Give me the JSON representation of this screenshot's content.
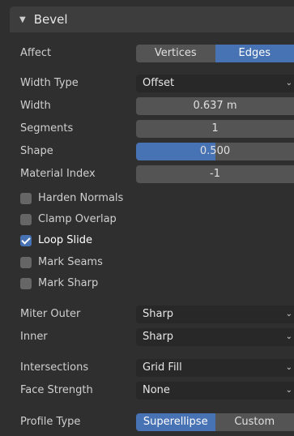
{
  "panel": {
    "title": "Bevel"
  },
  "affect": {
    "label": "Affect",
    "options": [
      "Vertices",
      "Edges"
    ],
    "selected": "Edges"
  },
  "width_type": {
    "label": "Width Type",
    "value": "Offset"
  },
  "width": {
    "label": "Width",
    "value": "0.637 m"
  },
  "segments": {
    "label": "Segments",
    "value": "1"
  },
  "shape": {
    "label": "Shape",
    "value": "0.500",
    "fraction": 0.5
  },
  "material_index": {
    "label": "Material Index",
    "value": "-1"
  },
  "checkboxes": [
    {
      "label": "Harden Normals",
      "checked": false
    },
    {
      "label": "Clamp Overlap",
      "checked": false
    },
    {
      "label": "Loop Slide",
      "checked": true
    },
    {
      "label": "Mark Seams",
      "checked": false
    },
    {
      "label": "Mark Sharp",
      "checked": false
    }
  ],
  "miter_outer": {
    "label": "Miter Outer",
    "value": "Sharp"
  },
  "inner": {
    "label": "Inner",
    "value": "Sharp"
  },
  "intersections": {
    "label": "Intersections",
    "value": "Grid Fill"
  },
  "face_strength": {
    "label": "Face Strength",
    "value": "None"
  },
  "profile_type": {
    "label": "Profile Type",
    "options": [
      "Superellipse",
      "Custom"
    ],
    "selected": "Superellipse"
  },
  "colors": {
    "accent": "#4772b3",
    "field": "#545454",
    "dropdown": "#282828",
    "panel": "#2f2f2f",
    "header": "#3d3d3d"
  },
  "icons": {
    "collapse": "triangle-down-icon",
    "dropdown": "chevron-down-icon",
    "check": "checkmark-icon"
  }
}
